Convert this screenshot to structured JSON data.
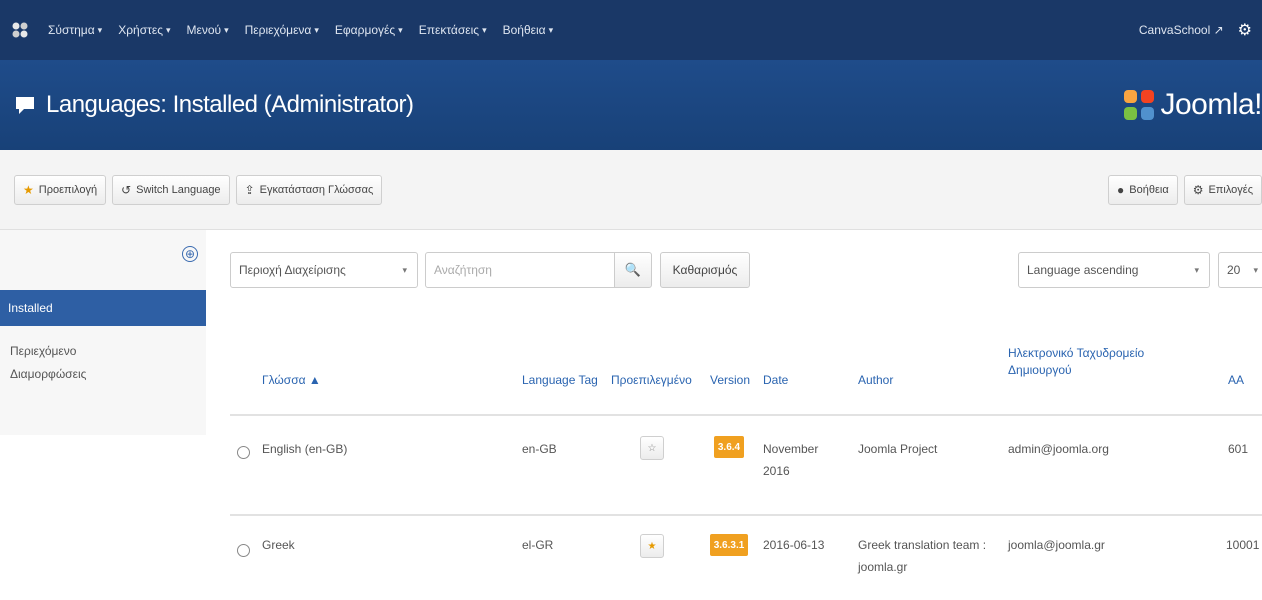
{
  "topnav": {
    "menus": [
      "Σύστημα",
      "Χρήστες",
      "Μενού",
      "Περιεχόμενα",
      "Εφαρμογές",
      "Επεκτάσεις",
      "Βοήθεια"
    ],
    "site_link": "CanvaSchool"
  },
  "header": {
    "title": "Languages: Installed (Administrator)",
    "brand": "Joomla!"
  },
  "toolbar": {
    "default_label": "Προεπιλογή",
    "switch_label": "Switch Language",
    "install_label": "Εγκατάσταση Γλώσσας",
    "help_label": "Βοήθεια",
    "options_label": "Επιλογές"
  },
  "sidebar": {
    "items": [
      "Installed",
      "Περιεχόμενο",
      "Διαμορφώσεις"
    ]
  },
  "filters": {
    "location_select": "Περιοχή Διαχείρισης",
    "search_placeholder": "Αναζήτηση",
    "clear_label": "Καθαρισμός",
    "sort_select": "Language ascending",
    "limit_select": "20"
  },
  "table": {
    "headers": {
      "language": "Γλώσσα",
      "tag": "Language Tag",
      "default": "Προεπιλεγμένο",
      "version": "Version",
      "date": "Date",
      "author": "Author",
      "email": "Ηλεκτρονικό Ταχυδρομείο Δημιουργού",
      "id": "ΑΑ"
    },
    "rows": [
      {
        "language": "English (en-GB)",
        "tag": "en-GB",
        "version": "3.6.4",
        "date": "November 2016",
        "author": "Joomla Project",
        "email": "admin@joomla.org",
        "id": "601"
      },
      {
        "language": "Greek",
        "tag": "el-GR",
        "version": "3.6.3.1",
        "date": "2016-06-13",
        "author": "Greek translation team : joomla.gr",
        "email": "joomla@joomla.gr",
        "id": "10001"
      }
    ]
  },
  "colors": {
    "topnav_bg": "#1a3867",
    "header_bg": "#1f4c8a",
    "sidebar_active": "#2e5fa4",
    "badge": "#f0a020"
  }
}
